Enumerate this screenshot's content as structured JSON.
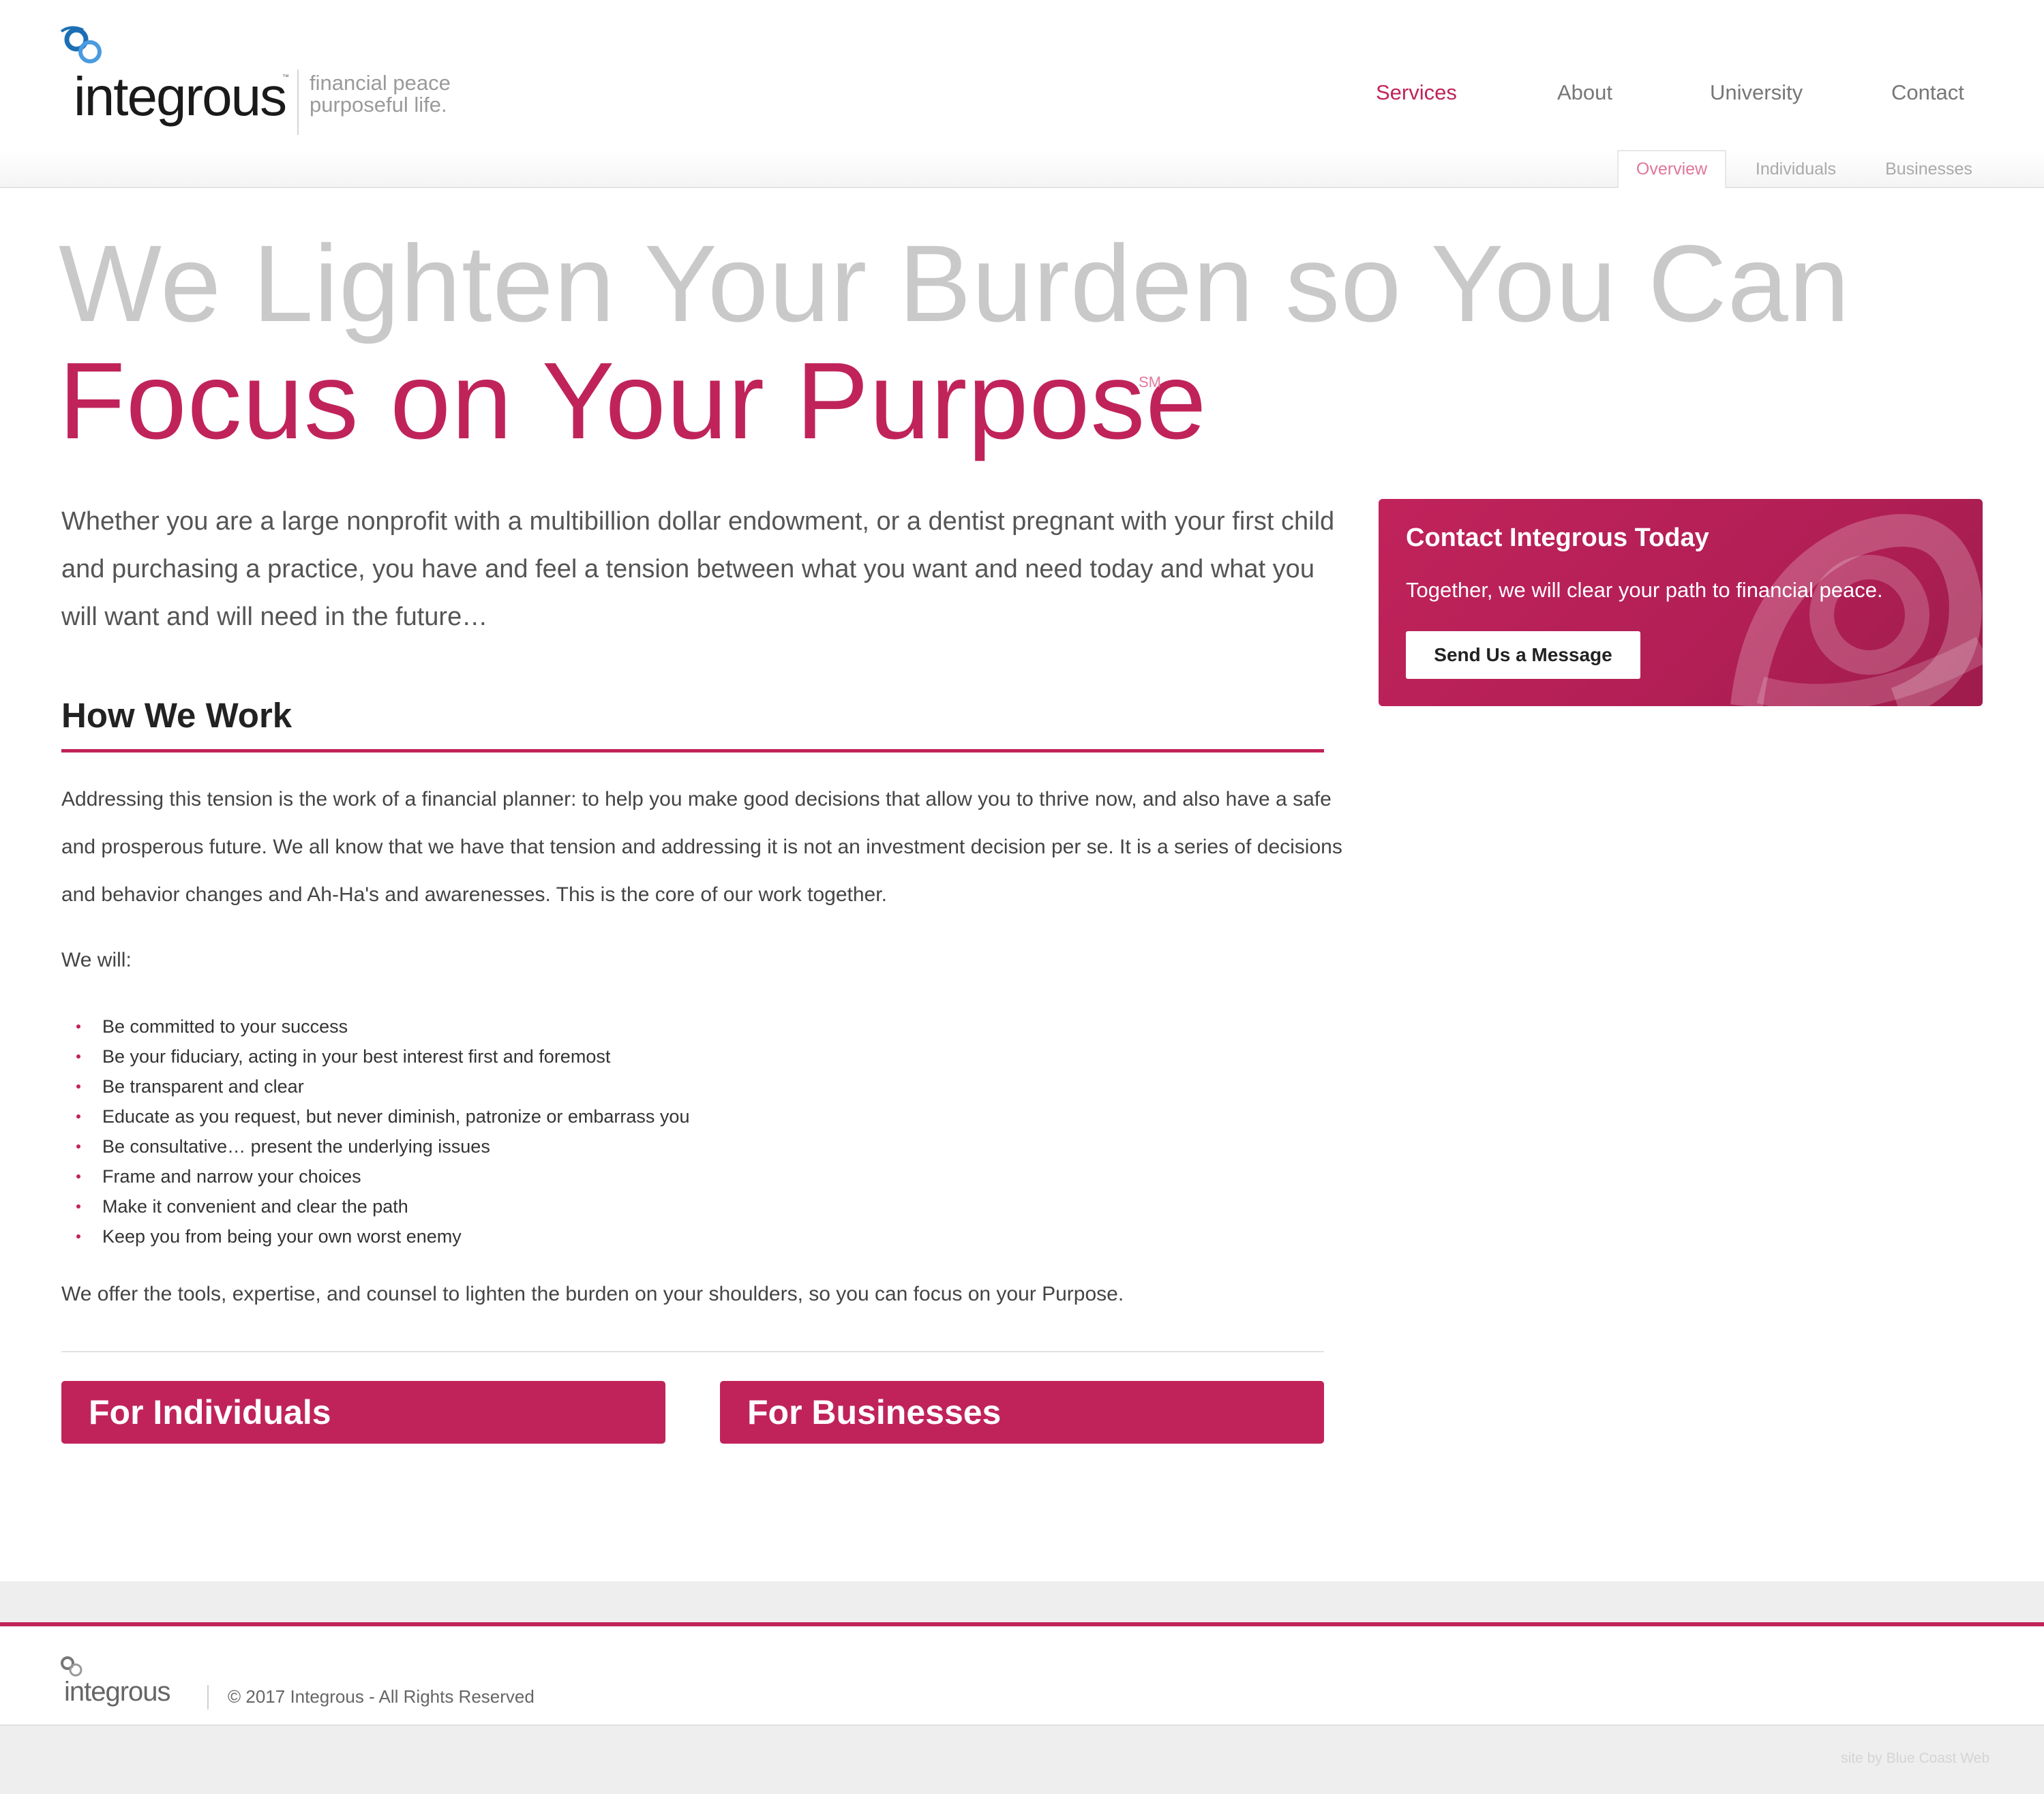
{
  "header": {
    "logo_text": "integrous",
    "logo_tm": "™",
    "tagline_line1": "financial peace",
    "tagline_line2": "purposeful life."
  },
  "main_nav": [
    {
      "label": "Services",
      "active": true
    },
    {
      "label": "About",
      "active": false
    },
    {
      "label": "University",
      "active": false
    },
    {
      "label": "Contact",
      "active": false
    }
  ],
  "sub_nav": [
    {
      "label": "Overview",
      "active": true
    },
    {
      "label": "Individuals",
      "active": false
    },
    {
      "label": "Businesses",
      "active": false
    }
  ],
  "hero": {
    "line1": "We Lighten Your Burden so You Can",
    "line2": "Focus on Your Purpose",
    "service_mark": "SM"
  },
  "intro": "Whether you are a large nonprofit with a multibillion dollar endowment, or a dentist pregnant with your first child and purchasing a practice, you have and feel a tension between what you want and need today and what you will want and will need in the future…",
  "how_we_work": {
    "title": "How We Work",
    "paragraph": "Addressing this tension is the work of a financial planner: to help you make good decisions that allow you to thrive now, and also have a safe and prosperous future. We all know that we have that tension and addressing it is not an investment decision per se. It is a series of decisions and behavior changes and Ah-Ha's and awarenesses. This is the core of our work together.",
    "we_will": "We will:",
    "items": [
      "Be committed to your success",
      "Be your fiduciary, acting in your best interest first and foremost",
      "Be transparent and clear",
      "Educate as you request, but never diminish, patronize or embarrass you",
      "Be consultative… present the underlying issues",
      "Frame and narrow your choices",
      "Make it convenient and clear the path",
      "Keep you from being your own worst enemy"
    ],
    "closing": "We offer the tools, expertise, and counsel to lighten the burden on your shoulders, so you can focus on your Purpose."
  },
  "cta_tiles": {
    "individuals": "For Individuals",
    "businesses": "For Businesses"
  },
  "contact_box": {
    "title": "Contact Integrous Today",
    "subtitle": "Together, we will clear your path to financial peace.",
    "button": "Send Us a Message"
  },
  "footer": {
    "logo_text": "integrous",
    "copyright": "© 2017 Integrous - All Rights Reserved",
    "credit": "site by Blue Coast Web"
  },
  "colors": {
    "brand": "#c0235a",
    "logo_blue": "#1c6fb5",
    "hero_grey": "#c9c9c9"
  }
}
